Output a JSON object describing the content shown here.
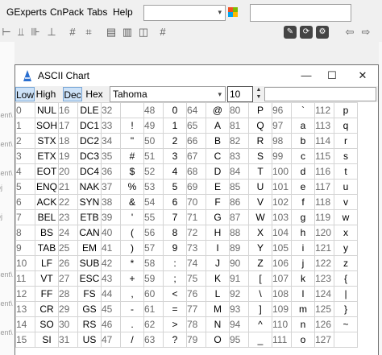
{
  "ide": {
    "menu": [
      "GExperts",
      "CnPack",
      "Tabs",
      "Help"
    ],
    "combo_arrow": "▾",
    "toolbar_icons": [
      "align-left-icon",
      "align-bottom-icon",
      "align-center-icon",
      "grid-align-icon",
      "grid-snap-icon",
      "layout-icon",
      "window-icon",
      "copy-window-icon",
      "grid-icon",
      "edit-icon",
      "refresh-icon",
      "settings-icon",
      "back-arrow-icon",
      "forward-arrow-icon"
    ],
    "left_strip_text": [
      "sent\\",
      "sent\\",
      "sent\\",
      "sent\\",
      "oj",
      "oj",
      "sent\\",
      "sent\\",
      "sent\\",
      "sent\\",
      "oj",
      "oj",
      "sent\\",
      "sent\\"
    ]
  },
  "window": {
    "title": "ASCII Chart",
    "minimize": "—",
    "maximize": "☐",
    "close": "✕"
  },
  "toolbar": {
    "low": "Low",
    "high": "High",
    "dec": "Dec",
    "hex": "Hex",
    "font": "Tahoma",
    "size": "10",
    "spin_up": "▲",
    "spin_down": "▼",
    "arrow": "▾"
  },
  "ascii_rows": [
    [
      [
        "0",
        "NUL"
      ],
      [
        "16",
        "DLE"
      ],
      [
        "32",
        ""
      ],
      [
        "48",
        "0"
      ],
      [
        "64",
        "@"
      ],
      [
        "80",
        "P"
      ],
      [
        "96",
        "`"
      ],
      [
        "112",
        "p"
      ]
    ],
    [
      [
        "1",
        "SOH"
      ],
      [
        "17",
        "DC1"
      ],
      [
        "33",
        "!"
      ],
      [
        "49",
        "1"
      ],
      [
        "65",
        "A"
      ],
      [
        "81",
        "Q"
      ],
      [
        "97",
        "a"
      ],
      [
        "113",
        "q"
      ]
    ],
    [
      [
        "2",
        "STX"
      ],
      [
        "18",
        "DC2"
      ],
      [
        "34",
        "\""
      ],
      [
        "50",
        "2"
      ],
      [
        "66",
        "B"
      ],
      [
        "82",
        "R"
      ],
      [
        "98",
        "b"
      ],
      [
        "114",
        "r"
      ]
    ],
    [
      [
        "3",
        "ETX"
      ],
      [
        "19",
        "DC3"
      ],
      [
        "35",
        "#"
      ],
      [
        "51",
        "3"
      ],
      [
        "67",
        "C"
      ],
      [
        "83",
        "S"
      ],
      [
        "99",
        "c"
      ],
      [
        "115",
        "s"
      ]
    ],
    [
      [
        "4",
        "EOT"
      ],
      [
        "20",
        "DC4"
      ],
      [
        "36",
        "$"
      ],
      [
        "52",
        "4"
      ],
      [
        "68",
        "D"
      ],
      [
        "84",
        "T"
      ],
      [
        "100",
        "d"
      ],
      [
        "116",
        "t"
      ]
    ],
    [
      [
        "5",
        "ENQ"
      ],
      [
        "21",
        "NAK"
      ],
      [
        "37",
        "%"
      ],
      [
        "53",
        "5"
      ],
      [
        "69",
        "E"
      ],
      [
        "85",
        "U"
      ],
      [
        "101",
        "e"
      ],
      [
        "117",
        "u"
      ]
    ],
    [
      [
        "6",
        "ACK"
      ],
      [
        "22",
        "SYN"
      ],
      [
        "38",
        "&"
      ],
      [
        "54",
        "6"
      ],
      [
        "70",
        "F"
      ],
      [
        "86",
        "V"
      ],
      [
        "102",
        "f"
      ],
      [
        "118",
        "v"
      ]
    ],
    [
      [
        "7",
        "BEL"
      ],
      [
        "23",
        "ETB"
      ],
      [
        "39",
        "'"
      ],
      [
        "55",
        "7"
      ],
      [
        "71",
        "G"
      ],
      [
        "87",
        "W"
      ],
      [
        "103",
        "g"
      ],
      [
        "119",
        "w"
      ]
    ],
    [
      [
        "8",
        "BS"
      ],
      [
        "24",
        "CAN"
      ],
      [
        "40",
        "("
      ],
      [
        "56",
        "8"
      ],
      [
        "72",
        "H"
      ],
      [
        "88",
        "X"
      ],
      [
        "104",
        "h"
      ],
      [
        "120",
        "x"
      ]
    ],
    [
      [
        "9",
        "TAB"
      ],
      [
        "25",
        "EM"
      ],
      [
        "41",
        ")"
      ],
      [
        "57",
        "9"
      ],
      [
        "73",
        "I"
      ],
      [
        "89",
        "Y"
      ],
      [
        "105",
        "i"
      ],
      [
        "121",
        "y"
      ]
    ],
    [
      [
        "10",
        "LF"
      ],
      [
        "26",
        "SUB"
      ],
      [
        "42",
        "*"
      ],
      [
        "58",
        ":"
      ],
      [
        "74",
        "J"
      ],
      [
        "90",
        "Z"
      ],
      [
        "106",
        "j"
      ],
      [
        "122",
        "z"
      ]
    ],
    [
      [
        "11",
        "VT"
      ],
      [
        "27",
        "ESC"
      ],
      [
        "43",
        "+"
      ],
      [
        "59",
        ";"
      ],
      [
        "75",
        "K"
      ],
      [
        "91",
        "["
      ],
      [
        "107",
        "k"
      ],
      [
        "123",
        "{"
      ]
    ],
    [
      [
        "12",
        "FF"
      ],
      [
        "28",
        "FS"
      ],
      [
        "44",
        ","
      ],
      [
        "60",
        "<"
      ],
      [
        "76",
        "L"
      ],
      [
        "92",
        "\\"
      ],
      [
        "108",
        "l"
      ],
      [
        "124",
        "|"
      ]
    ],
    [
      [
        "13",
        "CR"
      ],
      [
        "29",
        "GS"
      ],
      [
        "45",
        "-"
      ],
      [
        "61",
        "="
      ],
      [
        "77",
        "M"
      ],
      [
        "93",
        "]"
      ],
      [
        "109",
        "m"
      ],
      [
        "125",
        "}"
      ]
    ],
    [
      [
        "14",
        "SO"
      ],
      [
        "30",
        "RS"
      ],
      [
        "46",
        "."
      ],
      [
        "62",
        ">"
      ],
      [
        "78",
        "N"
      ],
      [
        "94",
        "^"
      ],
      [
        "110",
        "n"
      ],
      [
        "126",
        "~"
      ]
    ],
    [
      [
        "15",
        "SI"
      ],
      [
        "31",
        "US"
      ],
      [
        "47",
        "/"
      ],
      [
        "63",
        "?"
      ],
      [
        "79",
        "O"
      ],
      [
        "95",
        "_"
      ],
      [
        "111",
        "o"
      ],
      [
        "127",
        ""
      ]
    ]
  ]
}
